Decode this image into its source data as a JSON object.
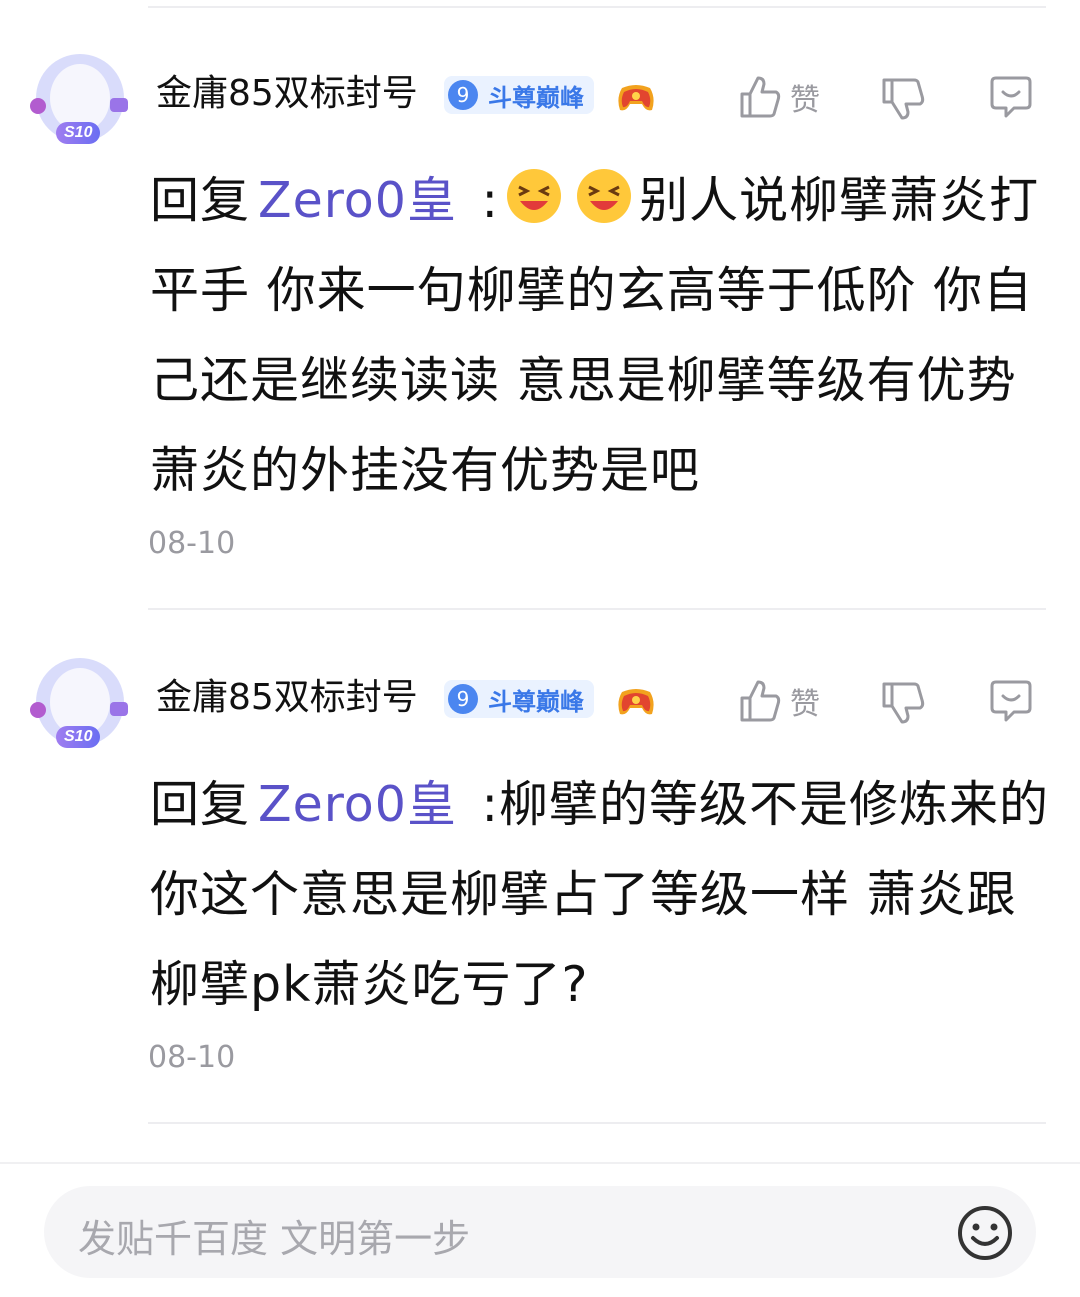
{
  "comments": [
    {
      "username": "金庸85双标封号",
      "badge_level": "9",
      "badge_title": "斗尊巅峰",
      "avatar_tag": "S10",
      "like_label": "赞",
      "reply_prefix": "回复",
      "mention": "Zero0皇",
      "text_before_emoji": " :",
      "text": "别人说柳擘萧炎打平手 你来一句柳擘的玄高等于低阶 你自己还是继续读读 意思是柳擘等级有优势萧炎的外挂没有优势是吧",
      "timestamp": "08-10"
    },
    {
      "username": "金庸85双标封号",
      "badge_level": "9",
      "badge_title": "斗尊巅峰",
      "avatar_tag": "S10",
      "like_label": "赞",
      "reply_prefix": "回复",
      "mention": "Zero0皇",
      "text": " :柳擘的等级不是修炼来的 你这个意思是柳擘占了等级一样 萧炎跟柳擘pk萧炎吃亏了?",
      "timestamp": "08-10"
    }
  ],
  "composer": {
    "placeholder": "发贴千百度 文明第一步"
  },
  "colors": {
    "mention": "#5a52c8",
    "badge_bg": "#eaf2ff",
    "badge_text": "#3a78e8",
    "muted": "#9a9aa0"
  },
  "icons": [
    "thumbs-up-icon",
    "thumbs-down-icon",
    "reply-icon",
    "smiley-icon",
    "game-controller-icon",
    "laughing-emoji"
  ]
}
